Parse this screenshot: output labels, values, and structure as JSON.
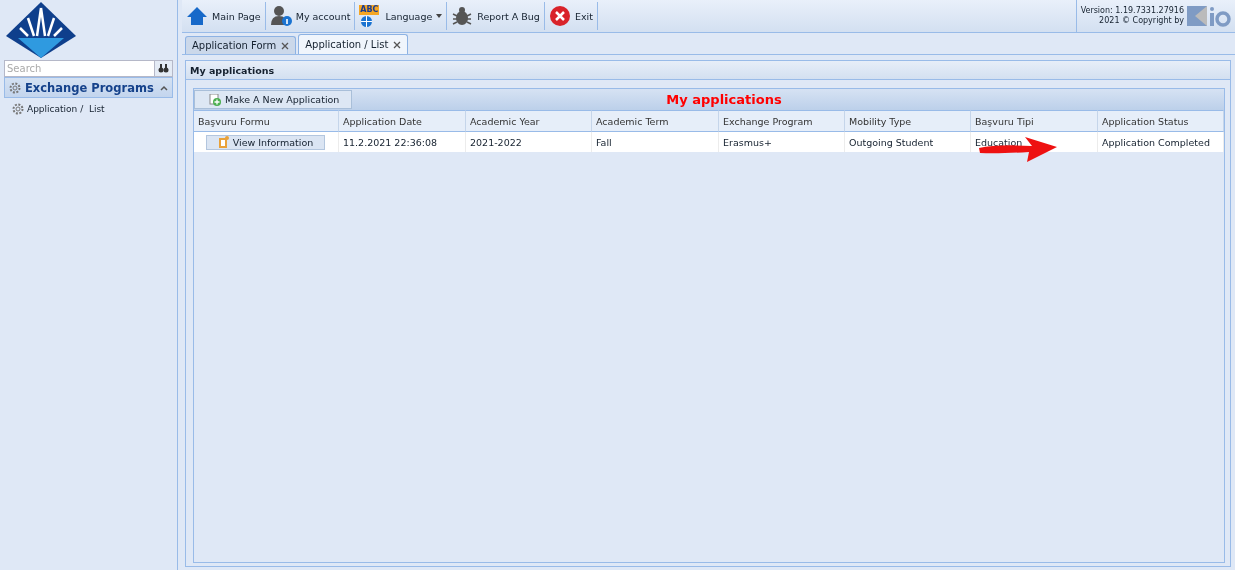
{
  "sidebar": {
    "search": {
      "placeholder": "Search"
    },
    "section": {
      "title": "Exchange Programs",
      "expanded": true
    },
    "items": [
      {
        "label": "Application /  List"
      }
    ]
  },
  "toolbar": {
    "buttons": [
      {
        "kind": "home",
        "label": "Main Page"
      },
      {
        "kind": "account",
        "label": "My account"
      },
      {
        "kind": "language",
        "label": "Language",
        "icon_text": "ABC"
      },
      {
        "kind": "bug",
        "label": "Report A Bug"
      },
      {
        "kind": "exit",
        "label": "Exit"
      }
    ],
    "version": "Version: 1.19.7331.27916",
    "copyright": "2021 © Copyright by"
  },
  "tabs": [
    {
      "label": "Application Form",
      "selected": false
    },
    {
      "label": "Application / List",
      "selected": true
    }
  ],
  "panel": {
    "title": "My applications",
    "grid_title": "My applications",
    "new_button": "Make A New Application",
    "columns": [
      "Başvuru Formu",
      "Application Date",
      "Academic Year",
      "Academic Term",
      "Exchange Program",
      "Mobility Type",
      "Başvuru Tipi",
      "Application Status"
    ],
    "rows": [
      {
        "cells": [
          "View Information",
          "11.2.2021 22:36:08",
          "2021-2022",
          "Fall",
          "Erasmus+",
          "Outgoing Student",
          "Education",
          "Application Completed"
        ]
      }
    ]
  }
}
